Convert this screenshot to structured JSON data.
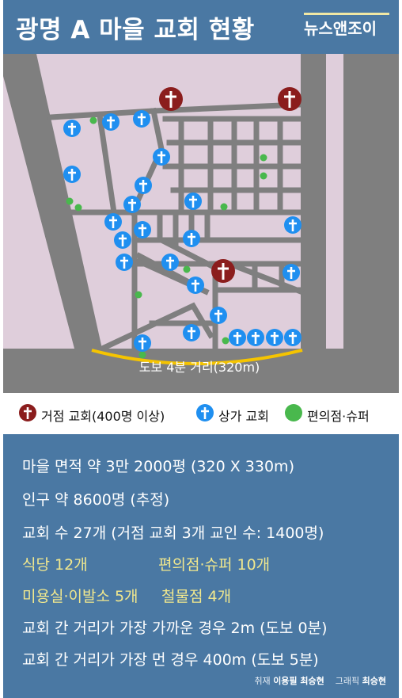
{
  "header": {
    "title": "광명 A 마을 교회 현황",
    "brand": "뉴스앤조이"
  },
  "map": {
    "distance_label": "도보 4분 거리(320m)"
  },
  "legend": {
    "hub_church": "거점 교회(400명 이상)",
    "storefront_church": "상가 교회",
    "convenience_store": "편의점·슈퍼"
  },
  "info": {
    "area": {
      "label": "마을 면적",
      "value": "약 3만 2000평 (320 X 330m)"
    },
    "population": {
      "label": "인구",
      "value": "약 8600명 (추정)"
    },
    "churches": "교회 수 27개 (거점 교회 3개 교인 수: 1400명)",
    "restaurants": {
      "label": "식당",
      "value": "12개"
    },
    "convenience": {
      "label": "편의점·슈퍼",
      "value": "10개"
    },
    "beauty": {
      "label": "미용실·이발소",
      "value": "5개"
    },
    "hardware": {
      "label": "철물점",
      "value": "4개"
    },
    "closest": "교회 간 거리가 가장 가까운 경우  2m (도보 0분)",
    "farthest": "교회 간 거리가 가장 먼 경우  400m (도보 5분)",
    "credit": {
      "report_label": "취재",
      "reporter": "이용필 최승현",
      "graphic_label": "그래픽",
      "designer": "최승현"
    }
  },
  "colors": {
    "header_bg": "#4a78a3",
    "map_bg": "#dfcedb",
    "road": "#7f7f7f",
    "hub": "#8b1d1d",
    "storefront": "#1f8ff0",
    "store": "#49b84d",
    "highlight": "#f1e88e"
  }
}
